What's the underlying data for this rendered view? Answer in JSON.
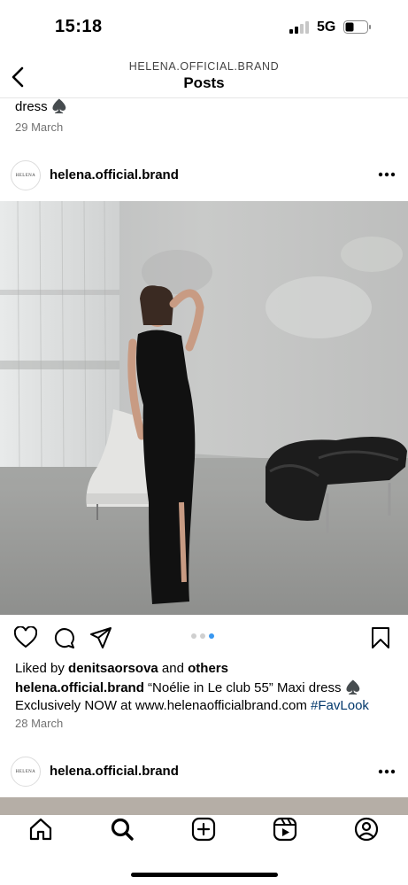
{
  "status_bar": {
    "time": "15:18",
    "network": "5G",
    "battery_level": 0.25
  },
  "nav": {
    "subtitle": "HELENA.OFFICIAL.BRAND",
    "title": "Posts"
  },
  "previous_post": {
    "caption_tail": "dress ♠️",
    "date": "29 March"
  },
  "post": {
    "avatar_text": "HELENA",
    "username": "helena.official.brand",
    "carousel": {
      "count": 3,
      "active": 3
    },
    "liked_by": {
      "prefix": "Liked by ",
      "user": "denitsaorsova",
      "mid": " and ",
      "others": "others"
    },
    "caption": {
      "username": "helena.official.brand",
      "text": " “Noélie in Le club 55” Maxi dress ♠️ Exclusively NOW at www.helenaofficialbrand.com ",
      "hashtag": "#FavLook"
    },
    "date": "28 March"
  },
  "next_post": {
    "avatar_text": "HELENA",
    "username": "helena.official.brand"
  },
  "icons": {
    "back": "chevron-left-icon",
    "more": "more-horizontal-icon",
    "like": "heart-icon",
    "comment": "comment-icon",
    "share": "paper-plane-icon",
    "save": "bookmark-icon",
    "home": "home-icon",
    "search": "search-icon",
    "create": "plus-square-icon",
    "reels": "reels-icon",
    "profile": "profile-icon"
  },
  "colors": {
    "link": "#00376b",
    "carousel_active": "#3897f0",
    "muted_text": "#737373"
  }
}
